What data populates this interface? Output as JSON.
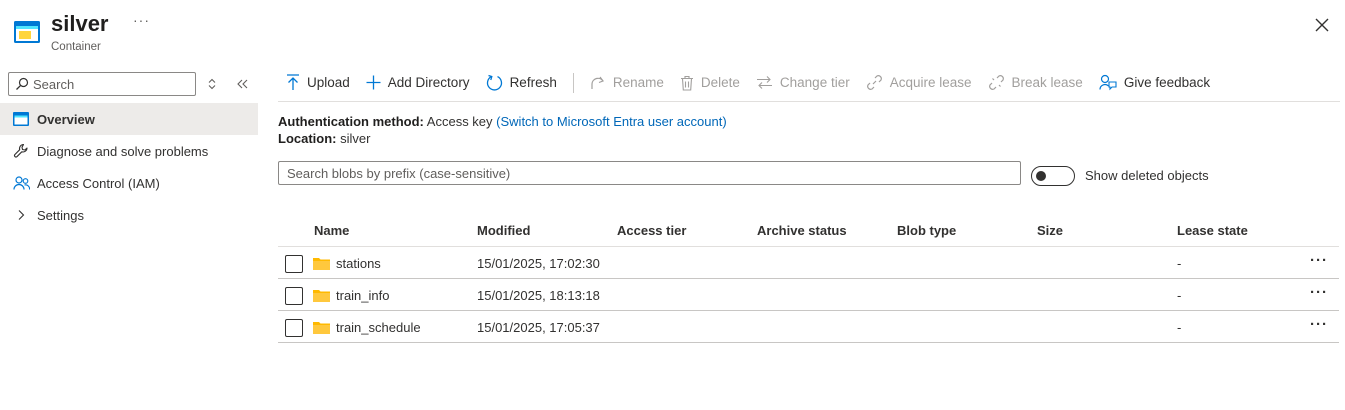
{
  "header": {
    "title": "silver",
    "subtitle": "Container",
    "more": "···"
  },
  "sidebar": {
    "search_placeholder": "Search",
    "items": [
      {
        "label": "Overview",
        "icon": "overview-icon",
        "active": true
      },
      {
        "label": "Diagnose and solve problems",
        "icon": "wrench-icon"
      },
      {
        "label": "Access Control (IAM)",
        "icon": "people-icon"
      },
      {
        "label": "Settings",
        "icon": "chevron-right-icon"
      }
    ]
  },
  "toolbar": {
    "upload": "Upload",
    "add_directory": "Add Directory",
    "refresh": "Refresh",
    "rename": "Rename",
    "delete": "Delete",
    "change_tier": "Change tier",
    "acquire_lease": "Acquire lease",
    "break_lease": "Break lease",
    "give_feedback": "Give feedback"
  },
  "info": {
    "auth_label": "Authentication method:",
    "auth_value": "Access key",
    "auth_link": "(Switch to Microsoft Entra user account)",
    "location_label": "Location:",
    "location_value": "silver"
  },
  "blob_search": {
    "placeholder": "Search blobs by prefix (case-sensitive)"
  },
  "toggle": {
    "label": "Show deleted objects",
    "on": false
  },
  "table": {
    "columns": [
      "Name",
      "Modified",
      "Access tier",
      "Archive status",
      "Blob type",
      "Size",
      "Lease state"
    ],
    "rows": [
      {
        "name": "stations",
        "modified": "15/01/2025, 17:02:30",
        "access_tier": "",
        "archive_status": "",
        "blob_type": "",
        "size": "",
        "lease_state": "-"
      },
      {
        "name": "train_info",
        "modified": "15/01/2025, 18:13:18",
        "access_tier": "",
        "archive_status": "",
        "blob_type": "",
        "size": "",
        "lease_state": "-"
      },
      {
        "name": "train_schedule",
        "modified": "15/01/2025, 17:05:37",
        "access_tier": "",
        "archive_status": "",
        "blob_type": "",
        "size": "",
        "lease_state": "-"
      }
    ],
    "row_more": "···"
  },
  "colors": {
    "accent": "#0078d4",
    "link": "#0067b8",
    "folder": "#ffb900",
    "active_nav_bg": "#edebe9",
    "disabled_text": "#a19f9d"
  }
}
